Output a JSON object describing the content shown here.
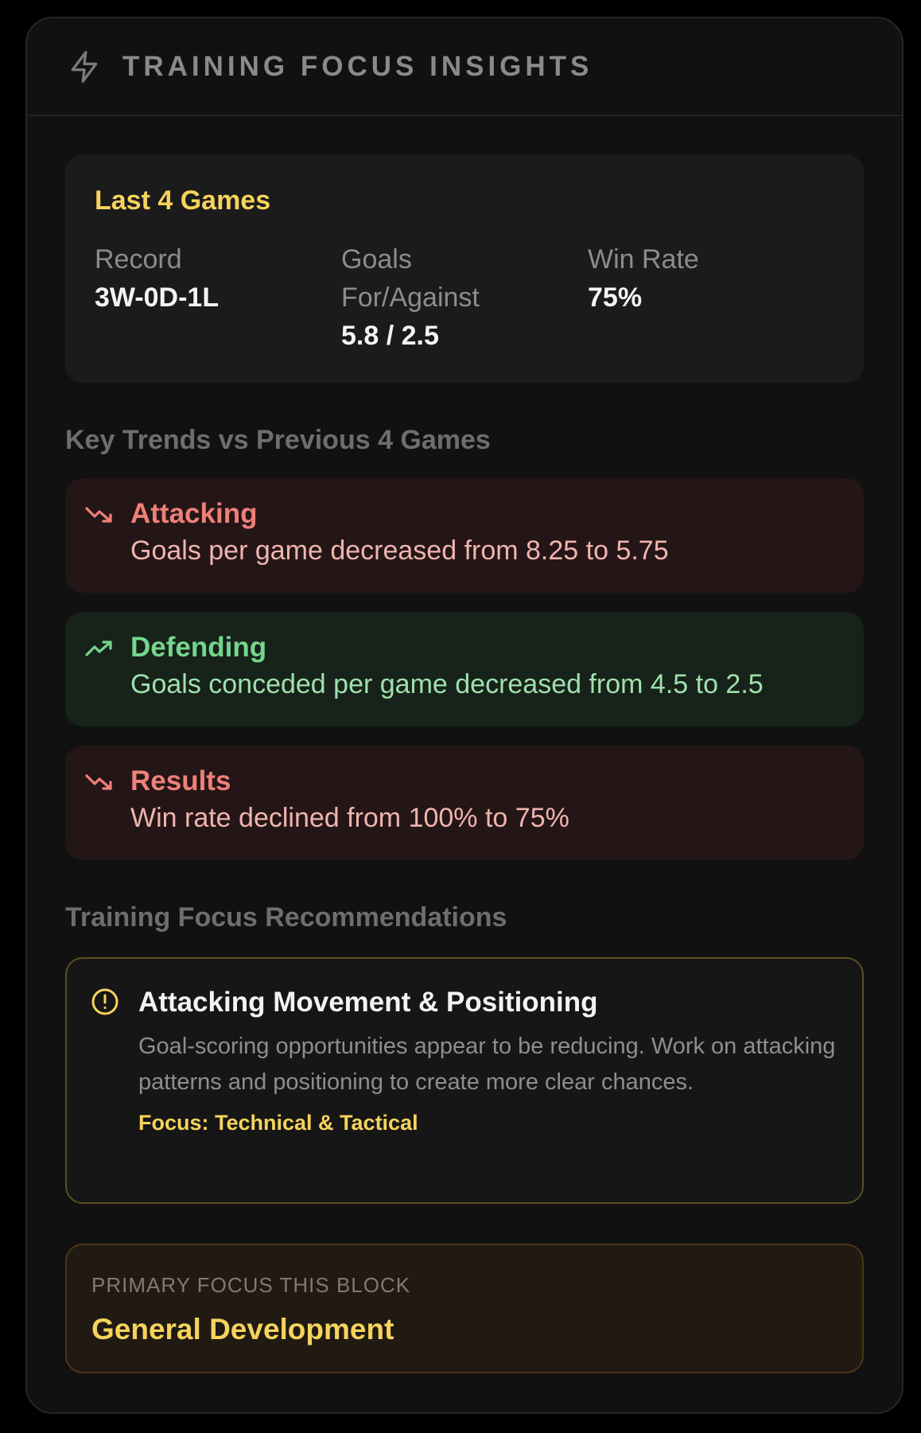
{
  "header": {
    "title": "TRAINING FOCUS INSIGHTS",
    "icon": "bolt-icon"
  },
  "summary": {
    "title": "Last 4 Games",
    "stats": [
      {
        "label": "Record",
        "value": "3W-0D-1L"
      },
      {
        "label": "Goals For/Against",
        "value": "5.8 / 2.5"
      },
      {
        "label": "Win Rate",
        "value": "75%"
      }
    ]
  },
  "trends": {
    "title": "Key Trends vs Previous 4 Games",
    "items": [
      {
        "name": "Attacking",
        "description": "Goals per game decreased from 8.25 to 5.75",
        "direction": "down",
        "color": "#ef8078"
      },
      {
        "name": "Defending",
        "description": "Goals conceded per game decreased from 4.5 to 2.5",
        "direction": "up",
        "color": "#74d68d"
      },
      {
        "name": "Results",
        "description": "Win rate declined from 100% to 75%",
        "direction": "down",
        "color": "#ef8078"
      }
    ]
  },
  "recommendations": {
    "title": "Training Focus Recommendations",
    "items": [
      {
        "icon": "alert-circle-icon",
        "heading": "Attacking Movement & Positioning",
        "body": "Goal-scoring opportunities appear to be reducing. Work on attacking patterns and positioning to create more clear chances.",
        "focus": "Focus: Technical & Tactical"
      }
    ]
  },
  "primary_focus": {
    "label": "PRIMARY FOCUS THIS BLOCK",
    "value": "General Development"
  },
  "colors": {
    "accent": "#f6d35c",
    "negative": "#ef8078",
    "positive": "#74d68d"
  }
}
